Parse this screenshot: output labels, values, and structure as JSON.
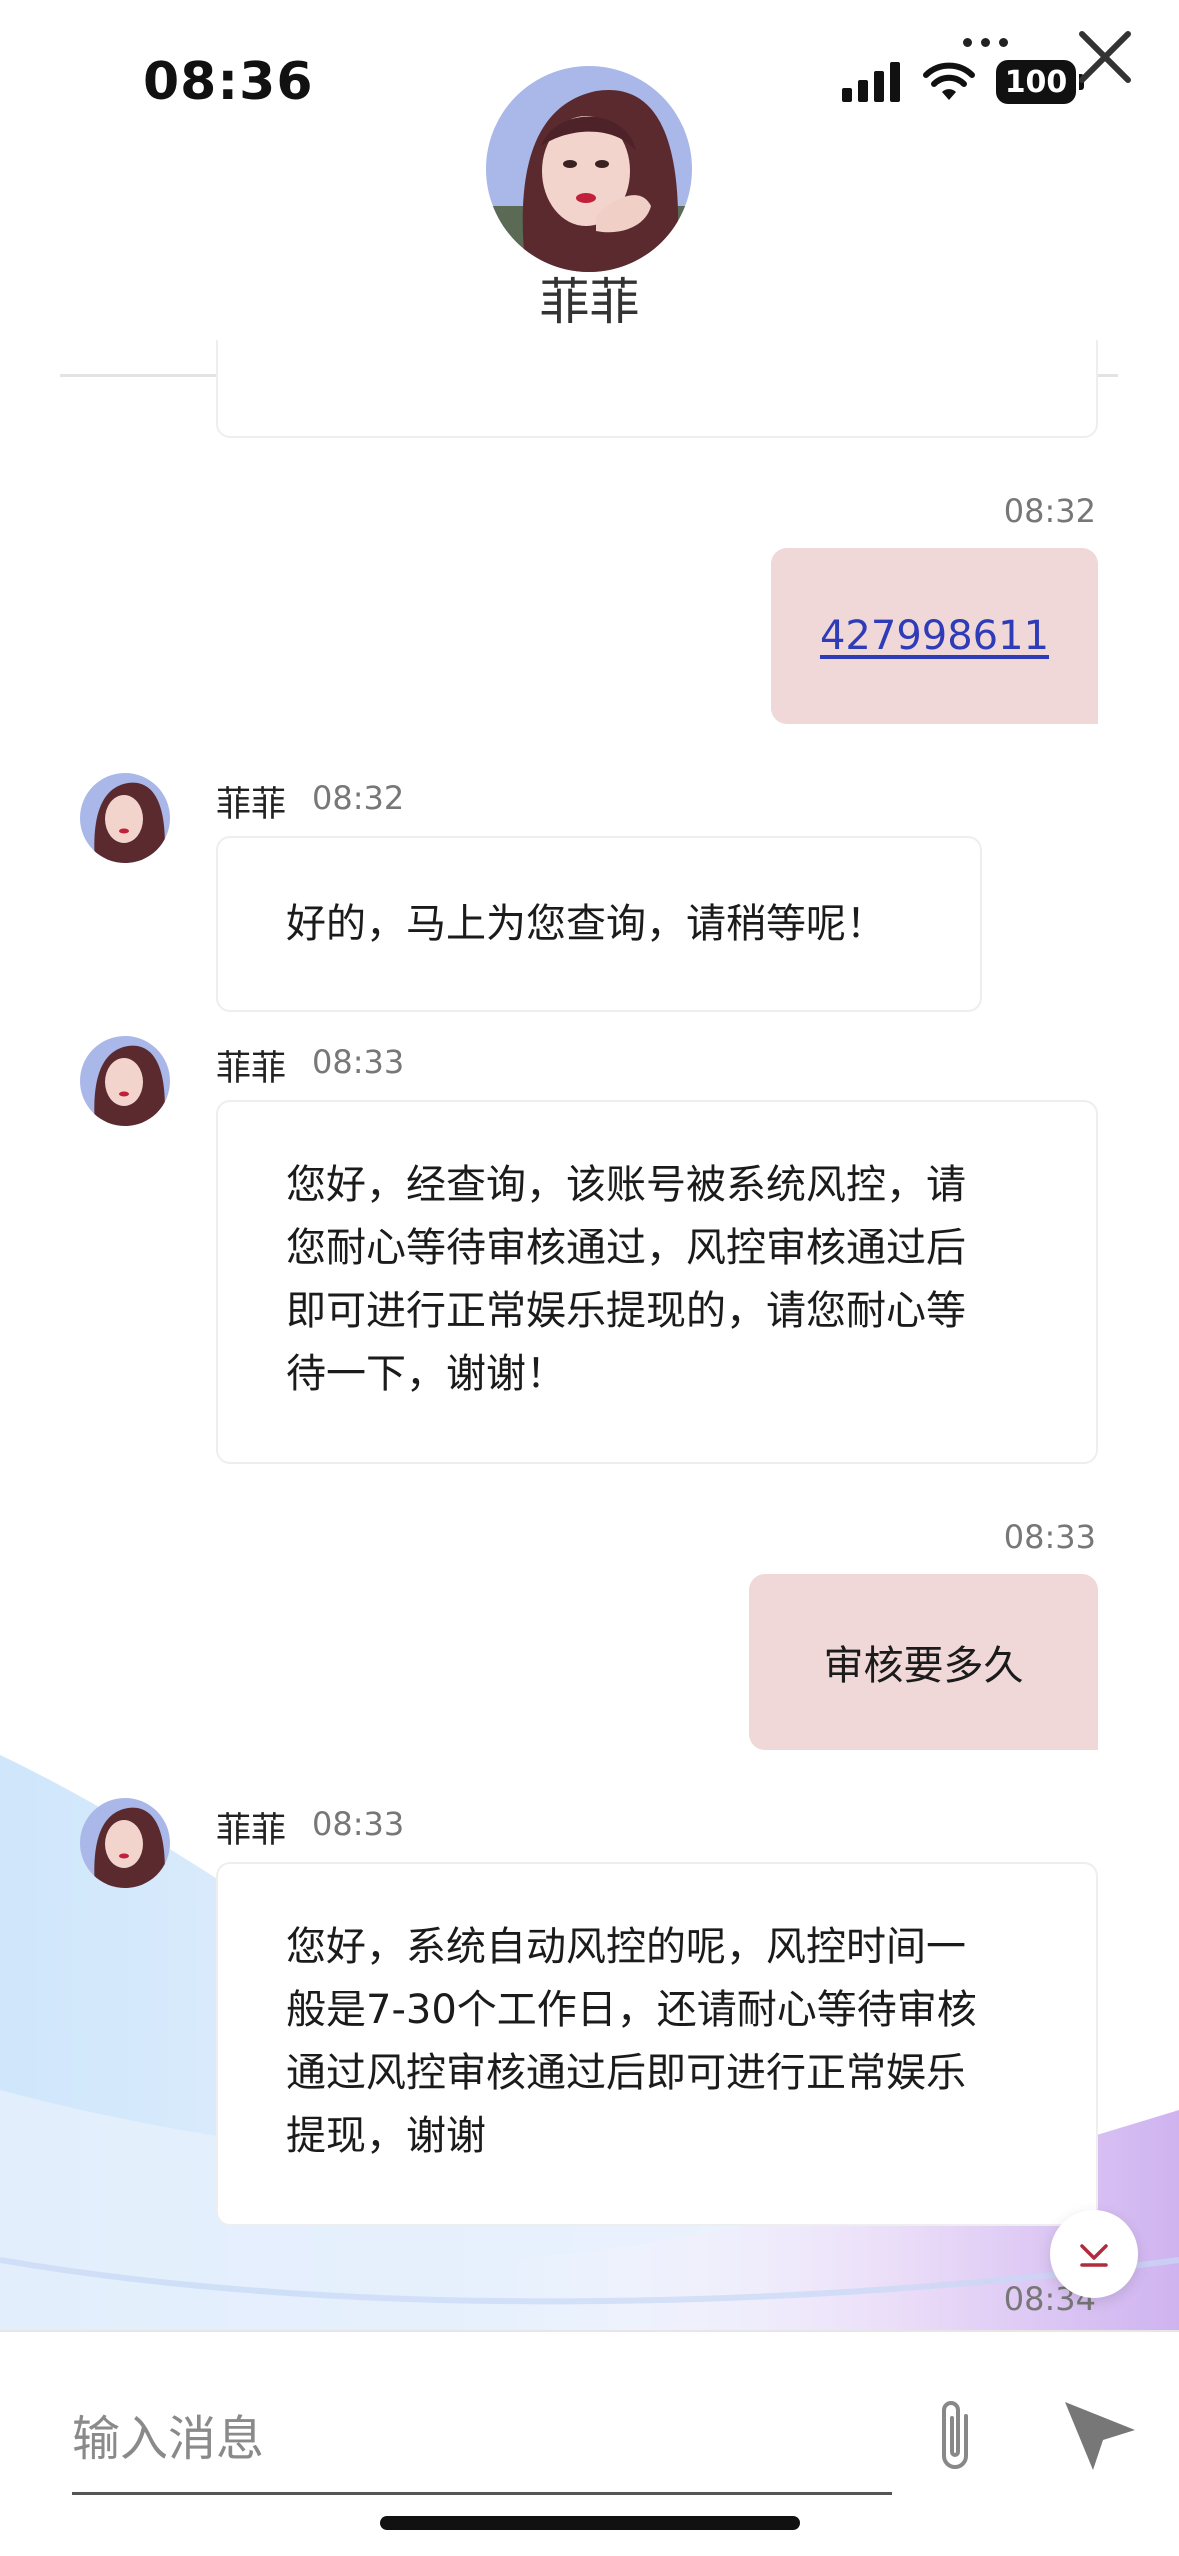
{
  "status_bar": {
    "time": "08:36",
    "battery": "100"
  },
  "header": {
    "agent_name": "菲菲"
  },
  "messages": [
    {
      "from": "me",
      "time": "08:32",
      "text": "427998611"
    },
    {
      "from": "agent",
      "name": "菲菲",
      "time": "08:32",
      "text": "好的，马上为您查询，请稍等呢！"
    },
    {
      "from": "agent",
      "name": "菲菲",
      "time": "08:33",
      "lines": [
        "您好，经查询，该账号被系统风控，请",
        "您耐心等待审核通过，风控审核通过后",
        "即可进行正常娱乐提现的，请您耐心等",
        "待一下，谢谢！"
      ]
    },
    {
      "from": "me",
      "time": "08:33",
      "text": "审核要多久"
    },
    {
      "from": "agent",
      "name": "菲菲",
      "time": "08:33",
      "lines": [
        "您好，系统自动风控的呢，风控时间一",
        "般是7-30个工作日，还请耐心等待审核",
        "通过风控审核通过后即可进行正常娱乐",
        "提现，谢谢"
      ]
    },
    {
      "from": "me",
      "time": "08:34"
    }
  ],
  "composer": {
    "placeholder": "输入消息"
  },
  "colors": {
    "outgoing_bubble": "#f0d7d8",
    "link": "#2f3cb8",
    "scroll_arrow": "#b02c3c"
  },
  "icons": {
    "close": "close-icon",
    "more": "more-icon",
    "attach": "paperclip-icon",
    "send": "send-icon",
    "scroll": "chevron-down-icon"
  }
}
